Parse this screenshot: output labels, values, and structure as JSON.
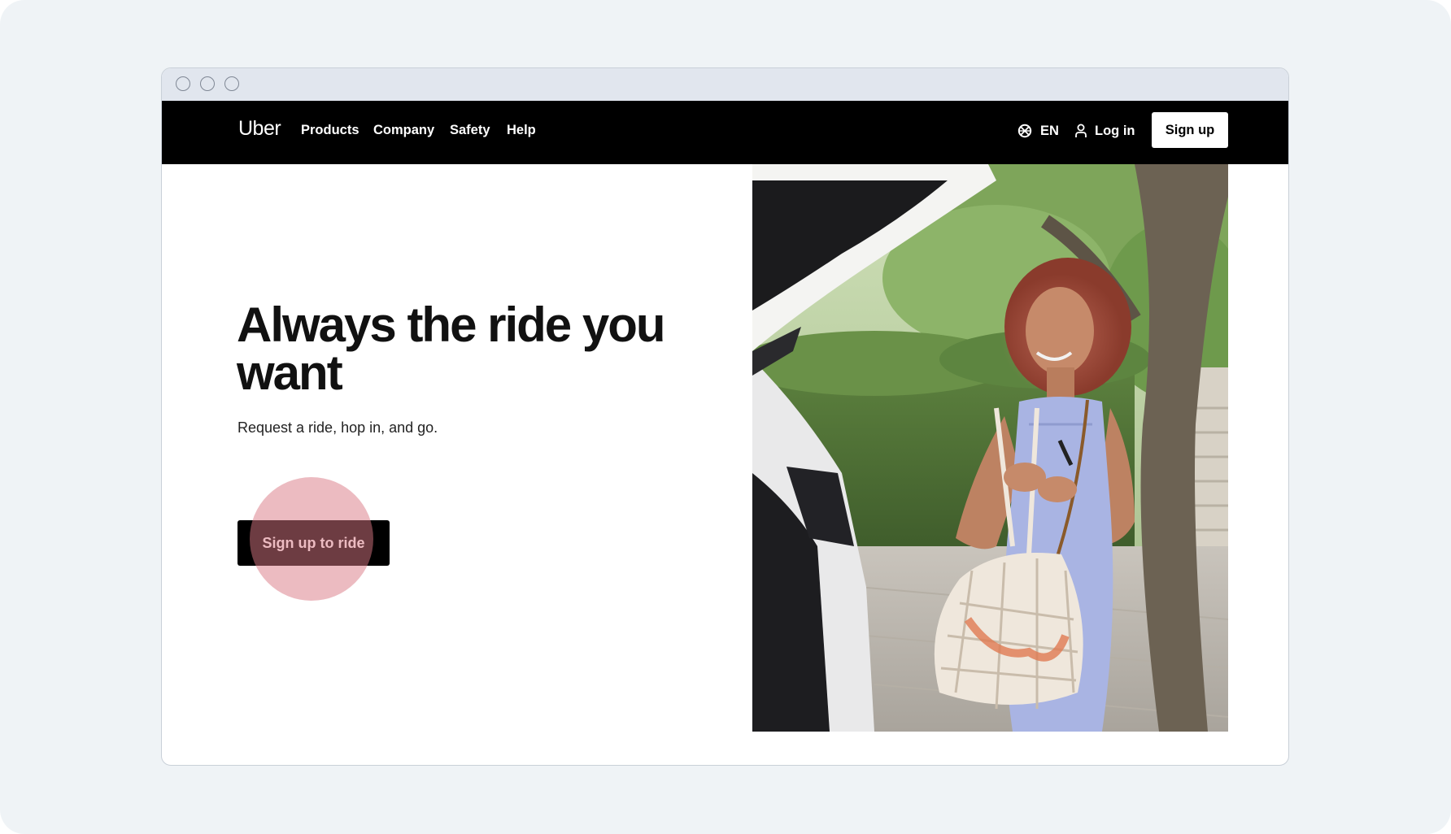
{
  "nav": {
    "logo": "Uber",
    "links": [
      "Products",
      "Company",
      "Safety",
      "Help"
    ],
    "language": "EN",
    "login": "Log in",
    "signup": "Sign up"
  },
  "hero": {
    "title": "Always the ride you want",
    "subtitle": "Request a ride, hop in, and go.",
    "cta": "Sign up to ride"
  },
  "colors": {
    "nav_background": "#000000",
    "page_background": "#eff3f6",
    "click_highlight": "#e8a3ab"
  },
  "icons": {
    "language": "globe-icon",
    "login": "person-icon"
  }
}
